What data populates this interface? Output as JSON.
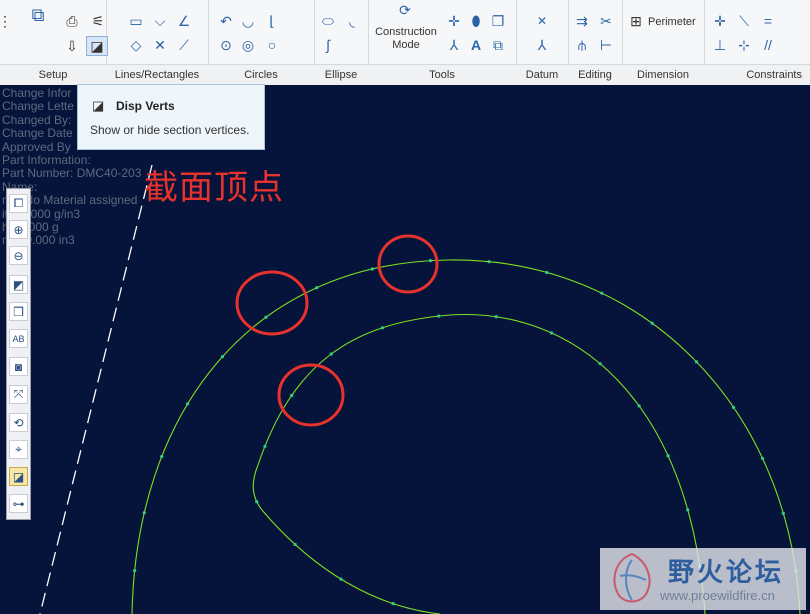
{
  "ribbon": {
    "groups": {
      "setup": "Setup",
      "lines": "Lines/Rectangles",
      "circles": "Circles",
      "ellipse": "Ellipse",
      "tools": "Tools",
      "datum": "Datum",
      "editing": "Editing",
      "dimension": "Dimension",
      "constraints": "Constraints"
    },
    "construction_mode": "Construction\nMode",
    "perimeter": "Perimeter"
  },
  "tooltip": {
    "title": "Disp Verts",
    "description": "Show or hide section vertices."
  },
  "model_info": [
    "Change Infor",
    "Change Lette",
    "Changed By:",
    "Change Date",
    "Approved By",
    "Part Information:",
    "Part Number: DMC40-203",
    "   Name:",
    "   rial: No Material assigned",
    "   ity: 0.000 g/in3",
    "   ht: 0.000 g",
    "   me: 0.000 in3"
  ],
  "annotation": "截面顶点",
  "watermark": {
    "title": "野火论坛",
    "url": "www.proewildfire.cn"
  },
  "colors": {
    "canvas": "#06133a",
    "curve": "#7ee01e",
    "vertex": "#2fd08a",
    "annotation": "#e8322d",
    "centerline": "#ffffff"
  }
}
